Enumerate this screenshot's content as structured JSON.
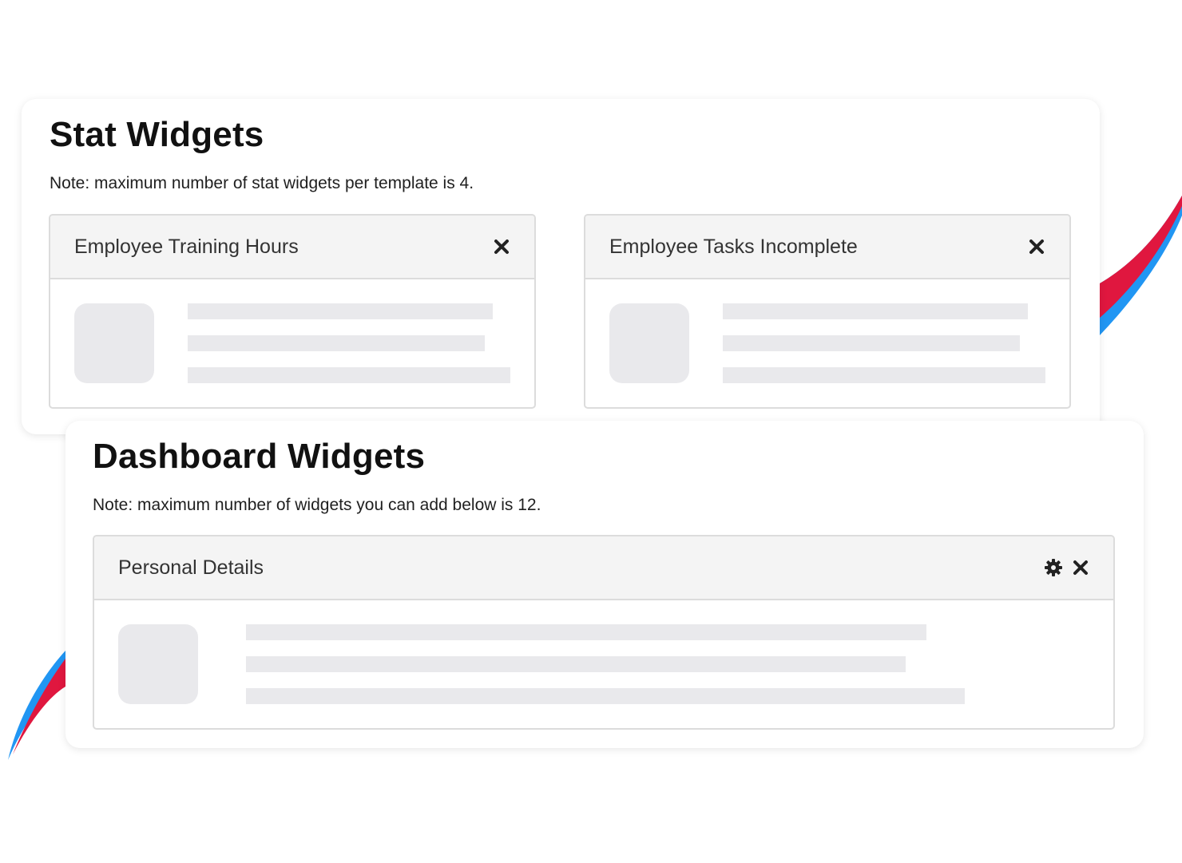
{
  "colors": {
    "accent_red": "#e0173f",
    "accent_blue": "#2196f3",
    "placeholder": "#e9e9ec",
    "header_bg": "#f4f4f4"
  },
  "stat_section": {
    "title": "Stat Widgets",
    "note": "Note: maximum number of stat widgets per template is 4.",
    "widgets": [
      {
        "title": "Employee Training Hours",
        "actions": [
          "close-icon"
        ]
      },
      {
        "title": "Employee Tasks Incomplete",
        "actions": [
          "close-icon"
        ]
      }
    ]
  },
  "dashboard_section": {
    "title": "Dashboard Widgets",
    "note": "Note: maximum number of widgets you can add below is 12.",
    "widgets": [
      {
        "title": "Personal Details",
        "actions": [
          "gear-icon",
          "close-icon"
        ]
      }
    ]
  }
}
